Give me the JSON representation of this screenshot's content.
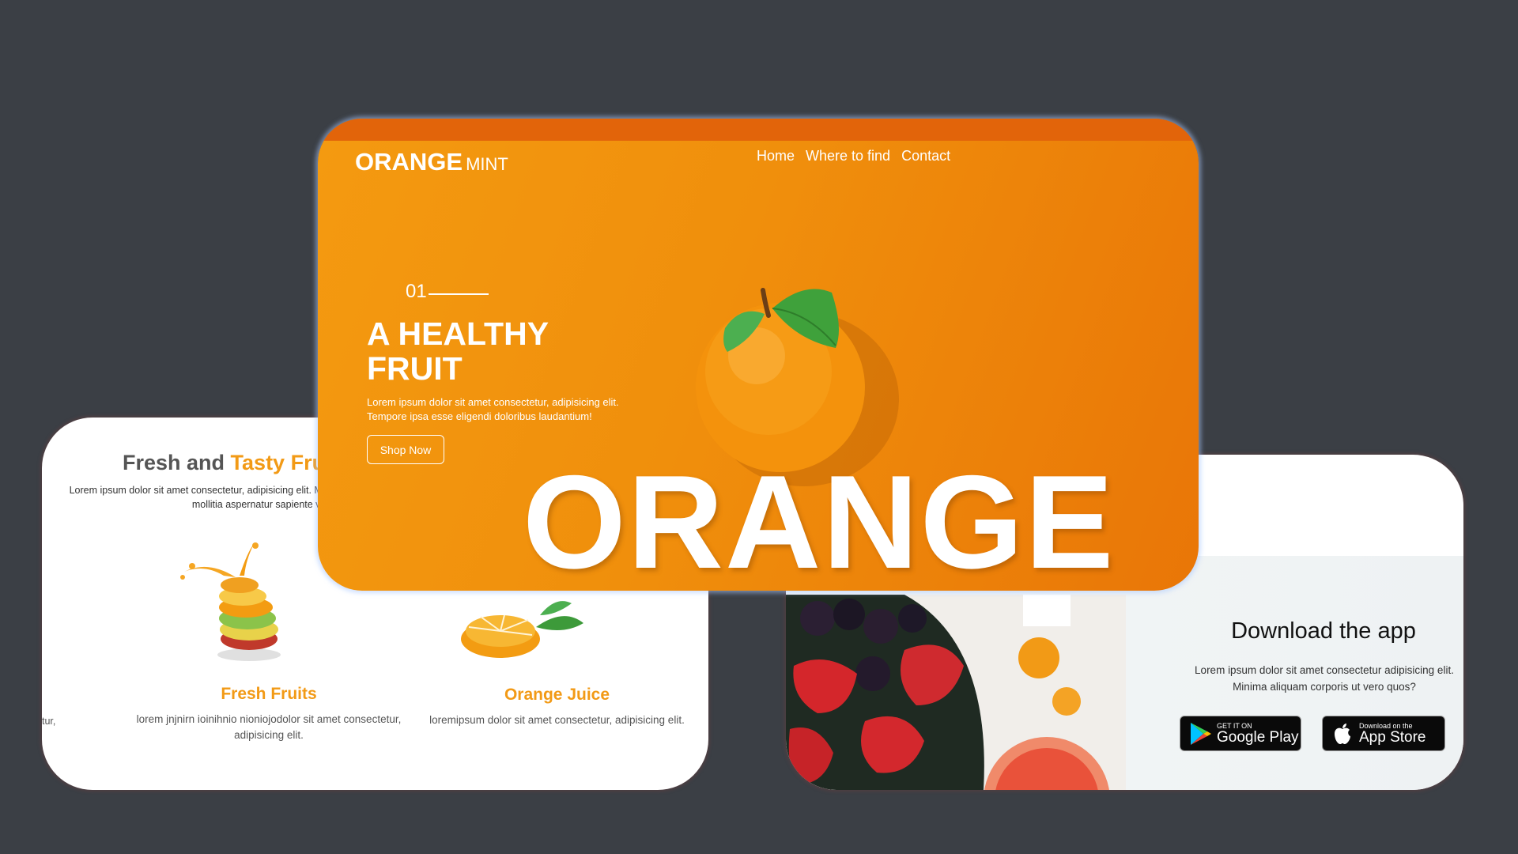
{
  "left_card": {
    "heading_part1": "Fresh and",
    "heading_part2": "Tasty Fruit",
    "paragraph": "Lorem ipsum dolor sit amet consectetur, adipisicing elit. Magni obcaecati similique esse mollitia aspernatur sapiente vol",
    "cut_text": "tur,",
    "items": [
      {
        "title": "Fresh Fruits",
        "desc": "lorem jnjnirn ioinihnio nioniojodolor sit amet consectetur, adipisicing elit."
      },
      {
        "title": "Orange Juice",
        "desc": "loremipsum dolor sit amet consectetur, adipisicing elit."
      }
    ]
  },
  "right_card": {
    "title": "Download the app",
    "text": "Lorem ipsum dolor sit amet consectetur adipisicing elit. Minima aliquam corporis ut vero quos?",
    "google_play": {
      "small": "GET IT ON",
      "big": "Google Play"
    },
    "app_store": {
      "small": "Download on the",
      "big": "App Store"
    }
  },
  "hero": {
    "logo_bold": "ORANGE",
    "logo_light": "MINT",
    "nav": [
      "Home",
      "Where to find",
      "Contact"
    ],
    "number": "01",
    "title": "A HEALTHY FRUIT",
    "text": "Lorem ipsum dolor sit amet consectetur, adipisicing elit. Tempore ipsa esse eligendi doloribus laudantium!",
    "button": "Shop Now",
    "big_word": "ORANGE"
  },
  "colors": {
    "background": "#3b3f45",
    "accent": "#f29a16",
    "hero_orange": "#f08f0c",
    "hero_topbar": "#e2640a"
  }
}
